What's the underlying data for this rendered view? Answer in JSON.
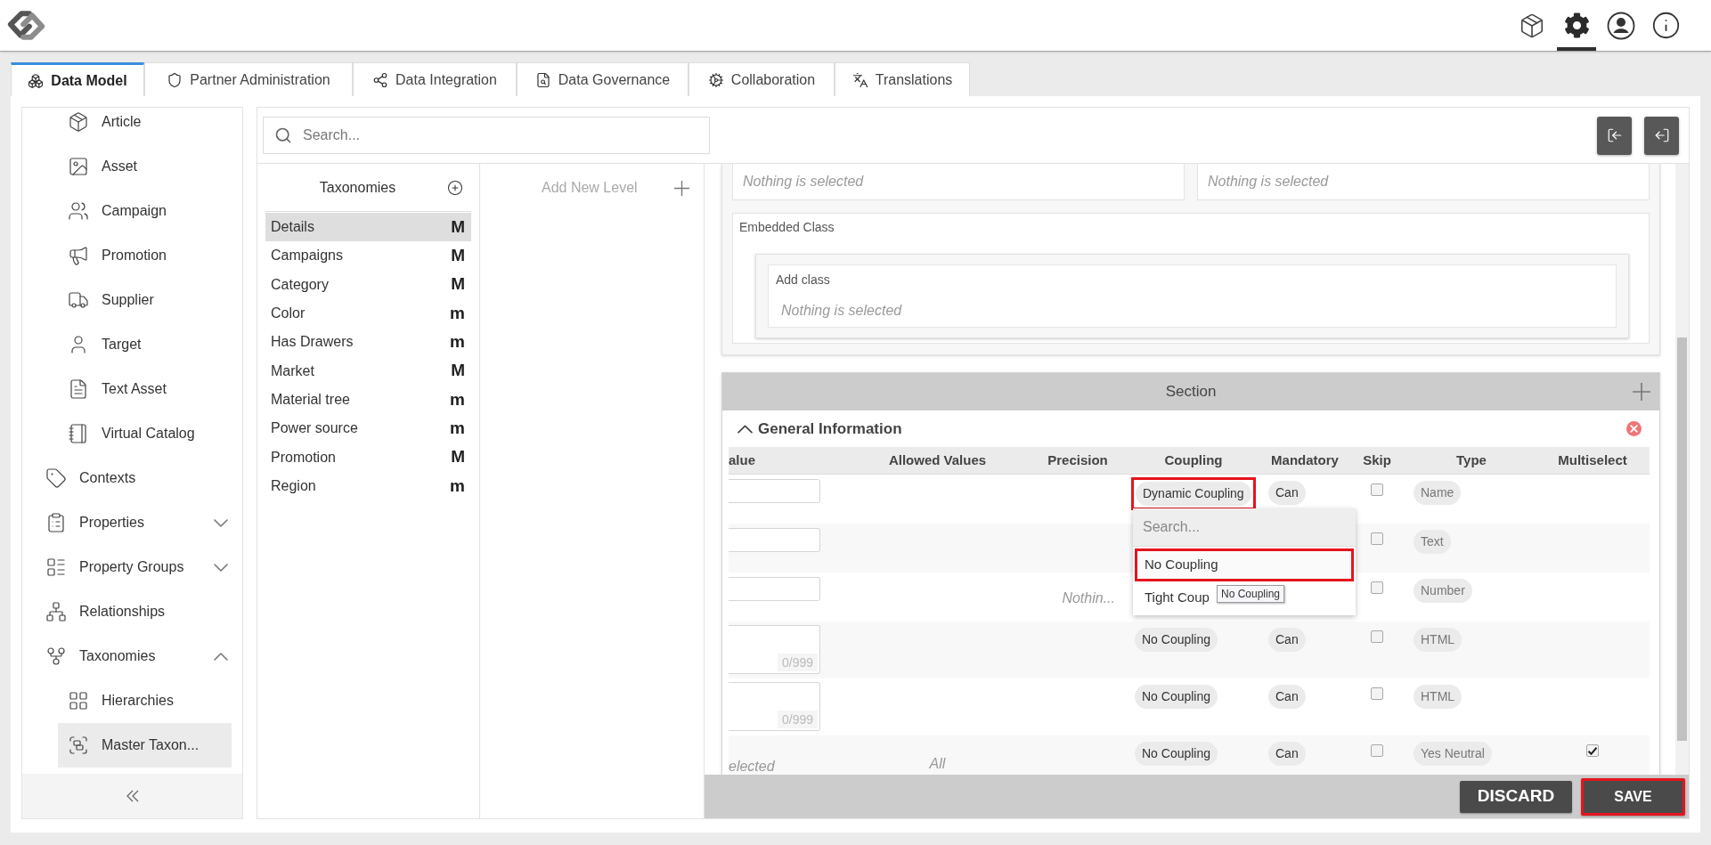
{
  "header": {
    "tools": [
      {
        "kind": "box",
        "selected": false
      },
      {
        "kind": "gear",
        "selected": true
      },
      {
        "kind": "user",
        "selected": false
      },
      {
        "kind": "info",
        "selected": false
      }
    ]
  },
  "tabs": [
    {
      "label": "Data Model",
      "selected": true
    },
    {
      "label": "Partner Administration",
      "selected": false
    },
    {
      "label": "Data Integration",
      "selected": false
    },
    {
      "label": "Data Governance",
      "selected": false
    },
    {
      "label": "Collaboration",
      "selected": false
    },
    {
      "label": "Translations",
      "selected": false
    }
  ],
  "sidebar": {
    "items": [
      {
        "children": [
          {
            "label": "Article",
            "selected": false
          },
          {
            "label": "Asset",
            "selected": false
          },
          {
            "label": "Campaign",
            "selected": false
          },
          {
            "label": "Promotion",
            "selected": false
          },
          {
            "label": "Supplier",
            "selected": false
          },
          {
            "label": "Target",
            "selected": false
          },
          {
            "label": "Text Asset",
            "selected": false
          },
          {
            "label": "Virtual Catalog",
            "selected": false
          }
        ]
      },
      {
        "label": "Contexts",
        "selected": false
      },
      {
        "label": "Properties",
        "selected": false,
        "expanded": false
      },
      {
        "label": "Property Groups",
        "selected": false,
        "expanded": false
      },
      {
        "label": "Relationships",
        "selected": false
      },
      {
        "label": "Taxonomies",
        "selected": false,
        "expanded": true,
        "children": [
          {
            "label": "Hierarchies",
            "selected": false
          },
          {
            "label": "Master Taxon...",
            "selected": true
          }
        ]
      }
    ]
  },
  "search": {
    "placeholder": "Search..."
  },
  "taxonomies": {
    "title": "Taxonomies",
    "items": [
      {
        "label": "Details",
        "badge": "M",
        "selected": true
      },
      {
        "label": "Campaigns",
        "badge": "M",
        "selected": false
      },
      {
        "label": "Category",
        "badge": "M",
        "selected": false
      },
      {
        "label": "Color",
        "badge": "m",
        "selected": false
      },
      {
        "label": "Has Drawers",
        "badge": "m",
        "selected": false
      },
      {
        "label": "Market",
        "badge": "M",
        "selected": false
      },
      {
        "label": "Material tree",
        "badge": "m",
        "selected": false
      },
      {
        "label": "Power source",
        "badge": "m",
        "selected": false
      },
      {
        "label": "Promotion",
        "badge": "M",
        "selected": false
      },
      {
        "label": "Region",
        "badge": "m",
        "selected": false
      }
    ]
  },
  "levels": {
    "add_label": "Add New Level"
  },
  "detail": {
    "fields": [
      {
        "placeholder": "Nothing is selected"
      },
      {
        "placeholder": "Nothing is selected"
      }
    ],
    "embedded_class": {
      "label": "Embedded Class",
      "add_class": {
        "label": "Add class",
        "placeholder": "Nothing is selected"
      }
    },
    "section": {
      "title": "Section",
      "group": {
        "title": "General Information",
        "expanded": true
      },
      "columns": [
        "alue",
        "Allowed Values",
        "Precision",
        "Coupling",
        "Mandatory",
        "Skip",
        "Type",
        "Multiselect"
      ],
      "rows": [
        {
          "value": {
            "kind": "input"
          },
          "coupling": {
            "label": "Dynamic Coupling",
            "highlighted": true
          },
          "mandatory": "Can",
          "skip": false,
          "type": "Name"
        },
        {
          "value": {
            "kind": "input"
          },
          "skip": false,
          "type": "Text"
        },
        {
          "value": {
            "kind": "input"
          },
          "precision": "Nothin...",
          "skip": false,
          "type": "Number"
        },
        {
          "value": {
            "kind": "textarea",
            "counter": "0/999"
          },
          "coupling": {
            "label": "No Coupling",
            "highlighted": false
          },
          "mandatory": "Can",
          "skip": false,
          "type": "HTML"
        },
        {
          "value": {
            "kind": "textarea",
            "counter": "0/999"
          },
          "coupling": {
            "label": "No Coupling",
            "highlighted": false
          },
          "mandatory": "Can",
          "skip": false,
          "type": "HTML"
        },
        {
          "value": {
            "kind": "text",
            "text": "elected"
          },
          "allowed_values": "All",
          "coupling": {
            "label": "No Coupling",
            "highlighted": false
          },
          "mandatory": "Can",
          "skip": false,
          "type": "Yes Neutral",
          "multiselect": true
        }
      ],
      "dropdown": {
        "search_placeholder": "Search...",
        "options": [
          {
            "label": "No Coupling",
            "highlighted": true
          },
          {
            "label": "Tight Coup",
            "highlighted": false
          }
        ],
        "tooltip": "No Coupling"
      }
    },
    "buttons": [
      {
        "label": "DISCARD",
        "highlighted": false
      },
      {
        "label": "SAVE",
        "highlighted": true
      }
    ]
  }
}
